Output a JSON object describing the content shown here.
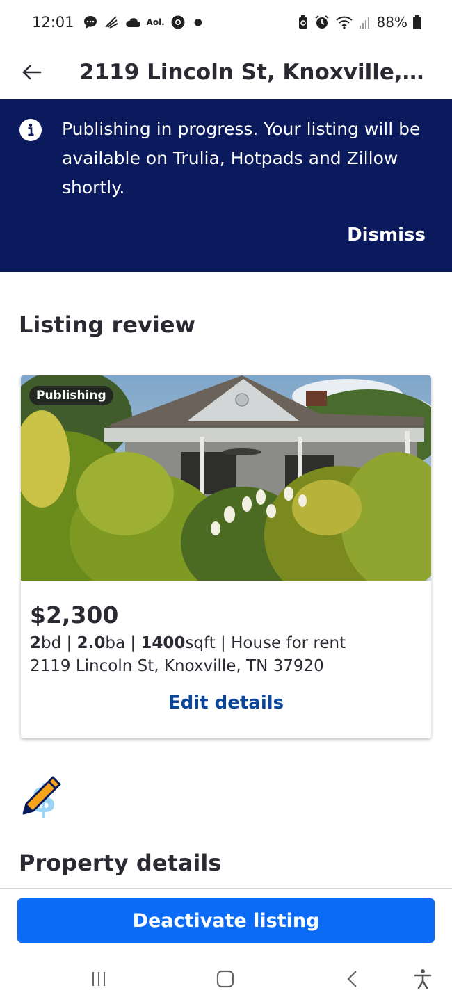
{
  "status_bar": {
    "time": "12:01",
    "aol_label": "Aol.",
    "battery": "88%",
    "icons": [
      "chat-bubble-icon",
      "bird-icon",
      "cloud-icon",
      "aol-icon",
      "chrome-icon",
      "dot-icon",
      "battery-saver-icon",
      "alarm-icon",
      "wifi-icon",
      "signal-icon",
      "battery-icon"
    ]
  },
  "header": {
    "title": "2119 Lincoln St, Knoxville, T..."
  },
  "banner": {
    "message": "Publishing in progress. Your listing will be available on Trulia, Hotpads and Zillow shortly.",
    "dismiss_label": "Dismiss",
    "color": "#0a1a5c"
  },
  "listing_review": {
    "title": "Listing review",
    "card": {
      "badge": "Publishing",
      "price": "$2,300",
      "beds": "2",
      "beds_unit": "bd",
      "baths": "2.0",
      "baths_unit": "ba",
      "sqft": "1400",
      "sqft_unit": "sqft",
      "separator": " | ",
      "type": "House for rent",
      "address": "2119 Lincoln St, Knoxville, TN 37920",
      "edit_label": "Edit details"
    }
  },
  "property_details": {
    "title": "Property details"
  },
  "footer": {
    "deactivate_label": "Deactivate listing",
    "button_color": "#0c6bf5"
  },
  "nav": {
    "icons": [
      "recent-apps-icon",
      "home-icon",
      "back-icon",
      "accessibility-icon"
    ]
  },
  "colors": {
    "link": "#0d4599",
    "text": "#2a2a33"
  }
}
